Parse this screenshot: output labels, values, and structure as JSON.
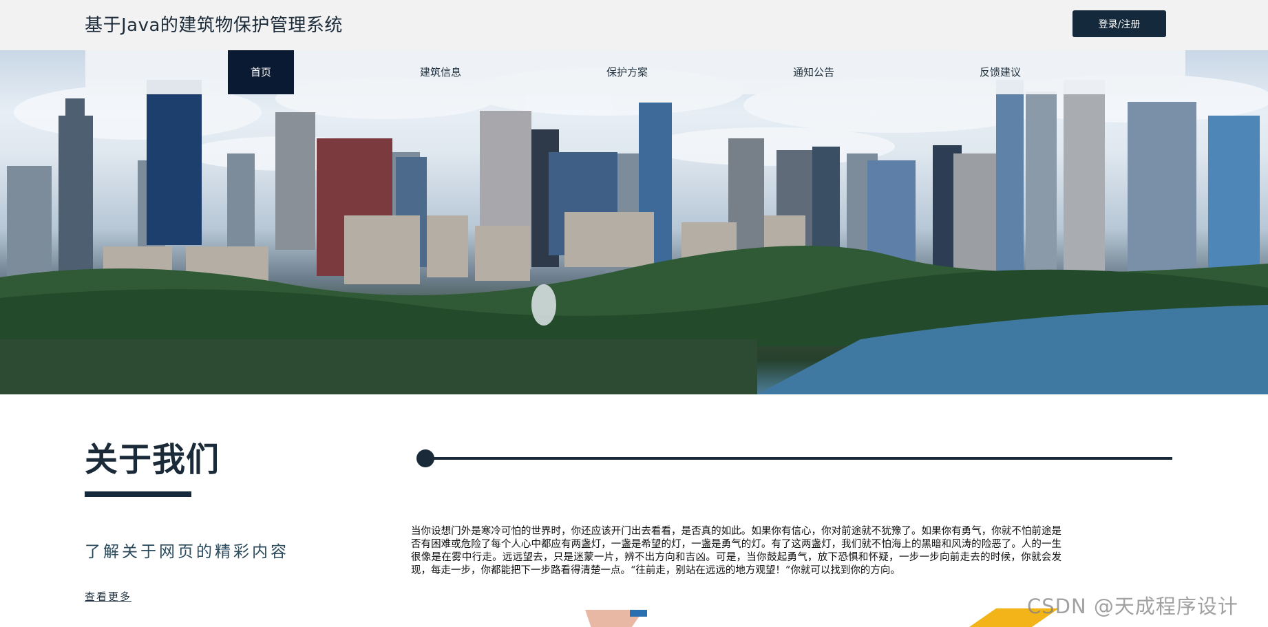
{
  "header": {
    "title": "基于Java的建筑物保护管理系统",
    "login_label": "登录/注册"
  },
  "nav": {
    "items": [
      {
        "label": "首页",
        "active": true
      },
      {
        "label": "建筑信息",
        "active": false
      },
      {
        "label": "保护方案",
        "active": false
      },
      {
        "label": "通知公告",
        "active": false
      },
      {
        "label": "反馈建议",
        "active": false
      }
    ]
  },
  "hero": {
    "image": "city-skyline-banner"
  },
  "about": {
    "title": "关于我们",
    "subtitle": "了解关于网页的精彩内容",
    "more_label": "查看更多",
    "text": "当你设想门外是寒冷可怕的世界时，你还应该开门出去看看，是否真的如此。如果你有信心，你对前途就不犹豫了。如果你有勇气，你就不怕前途是否有困难或危险了每个人心中都应有两盏灯，一盏是希望的灯，一盏是勇气的灯。有了这两盏灯，我们就不怕海上的黑暗和风涛的险恶了。人的一生很像是在雾中行走。远远望去，只是迷蒙一片，辨不出方向和吉凶。可是，当你鼓起勇气，放下恐惧和怀疑，一步一步向前走去的时候，你就会发现，每走一步，你都能把下一步路看得清楚一点。“往前走，别站在远远的地方观望！”你就可以找到你的方向。"
  },
  "watermark": {
    "text": "CSDN @天成程序设计"
  },
  "colors": {
    "primary": "#14293b",
    "nav_active": "#0b1a33",
    "topbar": "#f2f2f2"
  }
}
